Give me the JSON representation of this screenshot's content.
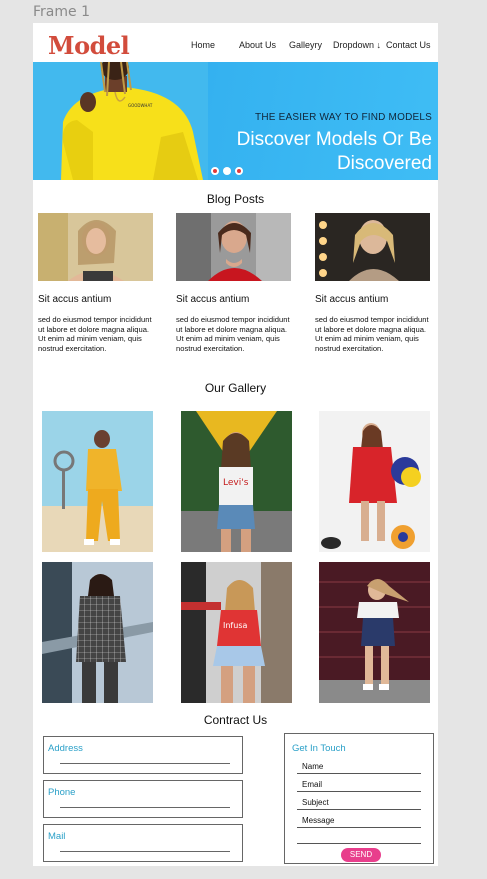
{
  "frame": {
    "label": "Frame 1"
  },
  "nav": {
    "logo": "Model",
    "links": [
      "Home",
      "About Us",
      "Galleyry",
      "Dropdown ↓",
      "Contact Us"
    ]
  },
  "hero": {
    "tagline": "THE EASIER WAY TO FIND MODELS",
    "title": "Discover Models Or Be Discovered",
    "slide_count": 3,
    "active_slide": 1,
    "background": "#35b2f0"
  },
  "blog": {
    "heading": "Blog Posts",
    "posts": [
      {
        "title": "Sit accus antium",
        "text": "sed do eiusmod tempor incididunt ut labore et dolore magna aliqua. Ut enim ad minim veniam, quis nostrud exercitation."
      },
      {
        "title": "Sit accus antium",
        "text": "sed do eiusmod tempor incididunt ut labore et dolore magna aliqua. Ut enim ad minim veniam, quis nostrud exercitation."
      },
      {
        "title": "Sit accus antium",
        "text": "sed do eiusmod tempor incididunt ut labore et dolore magna aliqua. Ut enim ad minim veniam, quis nostrud exercitation."
      }
    ]
  },
  "gallery": {
    "heading": "Our Gallery",
    "count": 6
  },
  "contact": {
    "heading": "Contract Us",
    "fields": [
      "Address",
      "Phone",
      "Mail"
    ],
    "touch": {
      "title": "Get In Touch",
      "inputs": [
        "Name",
        "Email",
        "Subject",
        "Message"
      ],
      "send": "SEND"
    },
    "accent": "#2aa0c8",
    "button_color": "#e83e8c"
  }
}
